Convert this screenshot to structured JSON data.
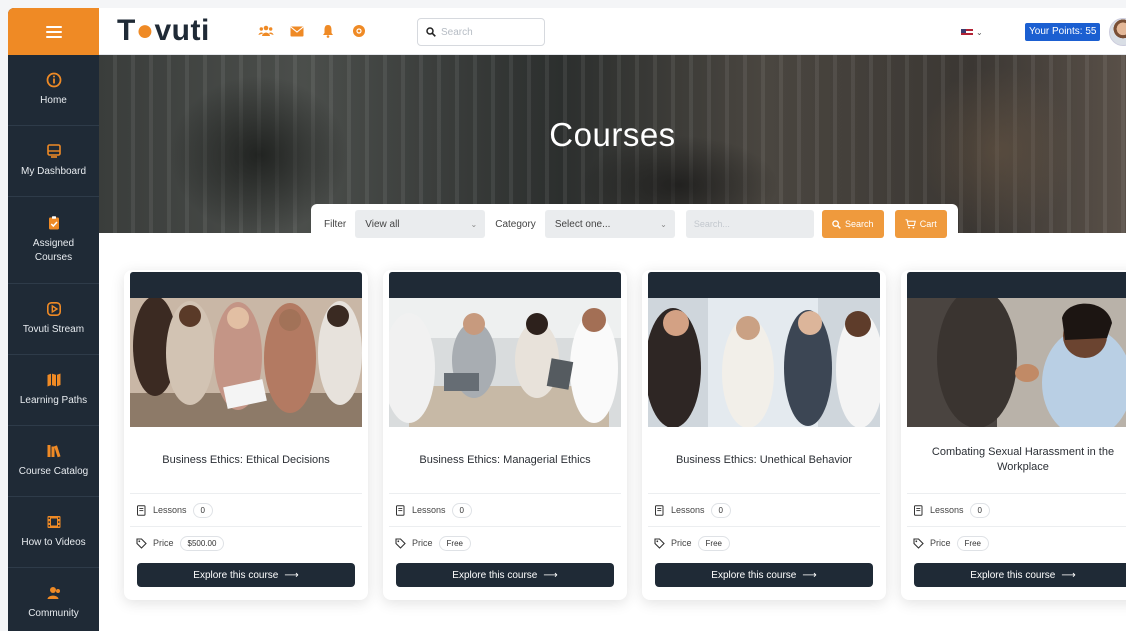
{
  "header": {
    "logo": "Tovuti",
    "search_placeholder": "Search",
    "points_label": "Your Points: 55"
  },
  "sidebar": {
    "items": [
      {
        "label": "Home",
        "icon": "info-circle-icon"
      },
      {
        "label": "My Dashboard",
        "icon": "dashboard-icon"
      },
      {
        "label": "Assigned Courses",
        "icon": "clipboard-check-icon"
      },
      {
        "label": "Tovuti Stream",
        "icon": "play-circle-icon"
      },
      {
        "label": "Learning Paths",
        "icon": "map-icon"
      },
      {
        "label": "Course Catalog",
        "icon": "books-icon"
      },
      {
        "label": "How to Videos",
        "icon": "film-icon"
      },
      {
        "label": "Community",
        "icon": "users-icon"
      }
    ]
  },
  "hero": {
    "title": "Courses"
  },
  "filters": {
    "filter_label": "Filter",
    "filter_value": "View all",
    "category_label": "Category",
    "category_value": "Select one...",
    "search_placeholder": "Search...",
    "search_button": "Search",
    "cart_button": "Cart"
  },
  "cards": [
    {
      "title": "Business Ethics: Ethical Decisions",
      "lessons_label": "Lessons",
      "lessons": "0",
      "price_label": "Price",
      "price": "$500.00",
      "cta": "Explore this course"
    },
    {
      "title": "Business Ethics: Managerial Ethics",
      "lessons_label": "Lessons",
      "lessons": "0",
      "price_label": "Price",
      "price": "Free",
      "cta": "Explore this course"
    },
    {
      "title": "Business Ethics: Unethical Behavior",
      "lessons_label": "Lessons",
      "lessons": "0",
      "price_label": "Price",
      "price": "Free",
      "cta": "Explore this course"
    },
    {
      "title": "Combating Sexual Harassment in the Workplace",
      "lessons_label": "Lessons",
      "lessons": "0",
      "price_label": "Price",
      "price": "Free",
      "cta": "Explore this course"
    }
  ],
  "colors": {
    "brand_orange": "#ef8a25",
    "sidebar_dark": "#1f2a36",
    "points_blue": "#1b5fd1"
  }
}
